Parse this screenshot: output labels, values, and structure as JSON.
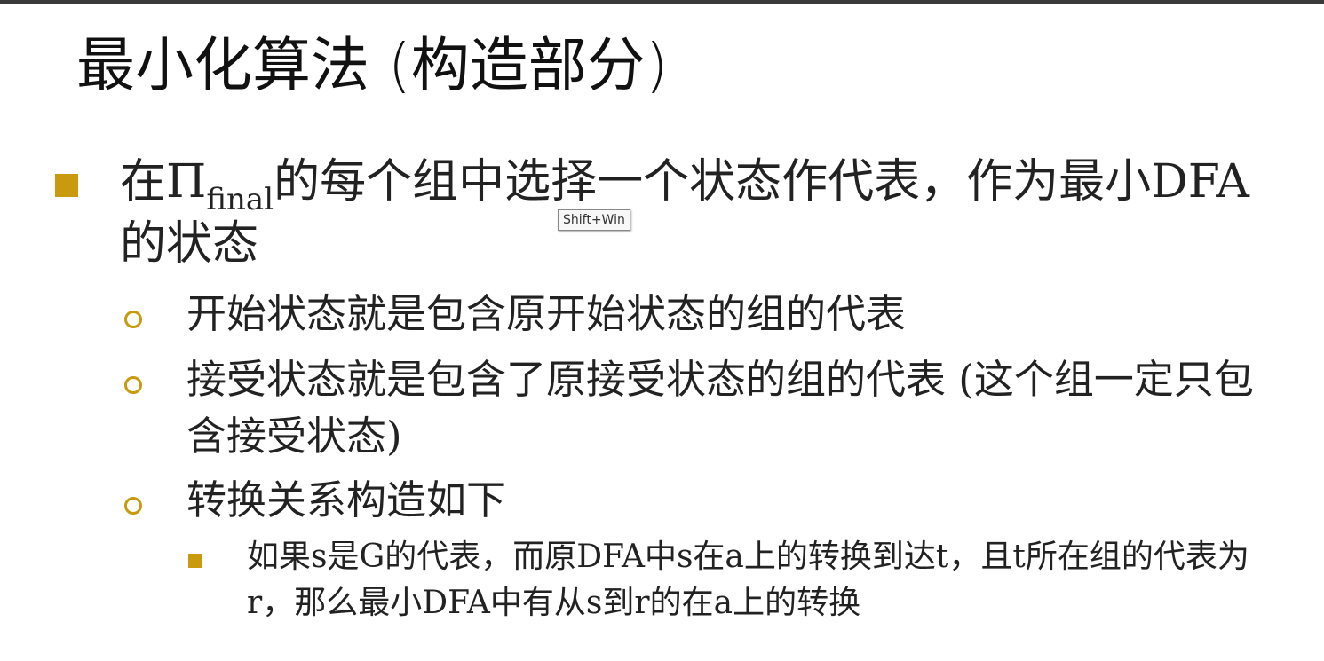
{
  "slide": {
    "title": "最小化算法 (构造部分)",
    "bullet1": {
      "prefix": "在Π",
      "subscript": "final",
      "suffix": "的每个组中选择一个状态作代表，作为最小DFA的状态"
    },
    "sub_bullets": [
      "开始状态就是包含原开始状态的组的代表",
      "接受状态就是包含了原接受状态的组的代表 (这个组一定只包含接受状态)",
      "转换关系构造如下"
    ],
    "sub_sub_bullet": "如果s是G的代表，而原DFA中s在a上的转换到达t，且t所在组的代表为r，那么最小DFA中有从s到r的在a上的转换"
  },
  "tooltip": "Shift+Win",
  "colors": {
    "bullet_accent": "#c99a0e",
    "text": "#222222"
  }
}
